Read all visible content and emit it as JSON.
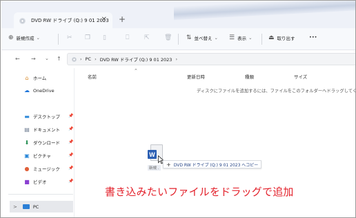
{
  "window": {
    "tab_title": "DVD RW ドライブ (Q:) 9 01 2023",
    "tab_close": "✕",
    "new_tab": "+"
  },
  "toolbar": {
    "new_label": "新規作成",
    "new_chevron": "⌄",
    "sort_label": "並べ替え",
    "sort_chevron": "⌄",
    "view_label": "表示",
    "view_chevron": "⌄",
    "eject_label": "取り出す",
    "more": "•••"
  },
  "address": {
    "back": "←",
    "forward": "→",
    "recent": "⌄",
    "up": "↑",
    "path": [
      "PC",
      "DVD RW ドライブ (Q:) 9 01 2023"
    ]
  },
  "sidebar": {
    "home": "ホーム",
    "onedrive": "OneDrive",
    "quick_access": [
      {
        "label": "デスクトップ",
        "icon": "desktop-icon"
      },
      {
        "label": "ドキュメント",
        "icon": "documents-icon"
      },
      {
        "label": "ダウンロード",
        "icon": "download-icon"
      },
      {
        "label": "ピクチャ",
        "icon": "pictures-icon"
      },
      {
        "label": "ミュージック",
        "icon": "music-icon"
      },
      {
        "label": "ビデオ",
        "icon": "videos-icon"
      }
    ],
    "pc": "PC",
    "pc_expand": ">"
  },
  "columns": {
    "name": "名前",
    "modified": "更新日時",
    "type": "種類",
    "size": "サイズ"
  },
  "content": {
    "empty_message": "ディスクにファイルを追加するには、ファイルをこのフォルダーへドラッグしてください。"
  },
  "drag": {
    "icon_letter": "W",
    "file_name": "新規 .",
    "tooltip_plus": "+",
    "tooltip_text": "DVD RW ドライブ (Q:) 9 01 2023 へコピー"
  },
  "annotation": {
    "caption": "書き込みたいファイルをドラッグで追加",
    "color": "#e3212b"
  }
}
